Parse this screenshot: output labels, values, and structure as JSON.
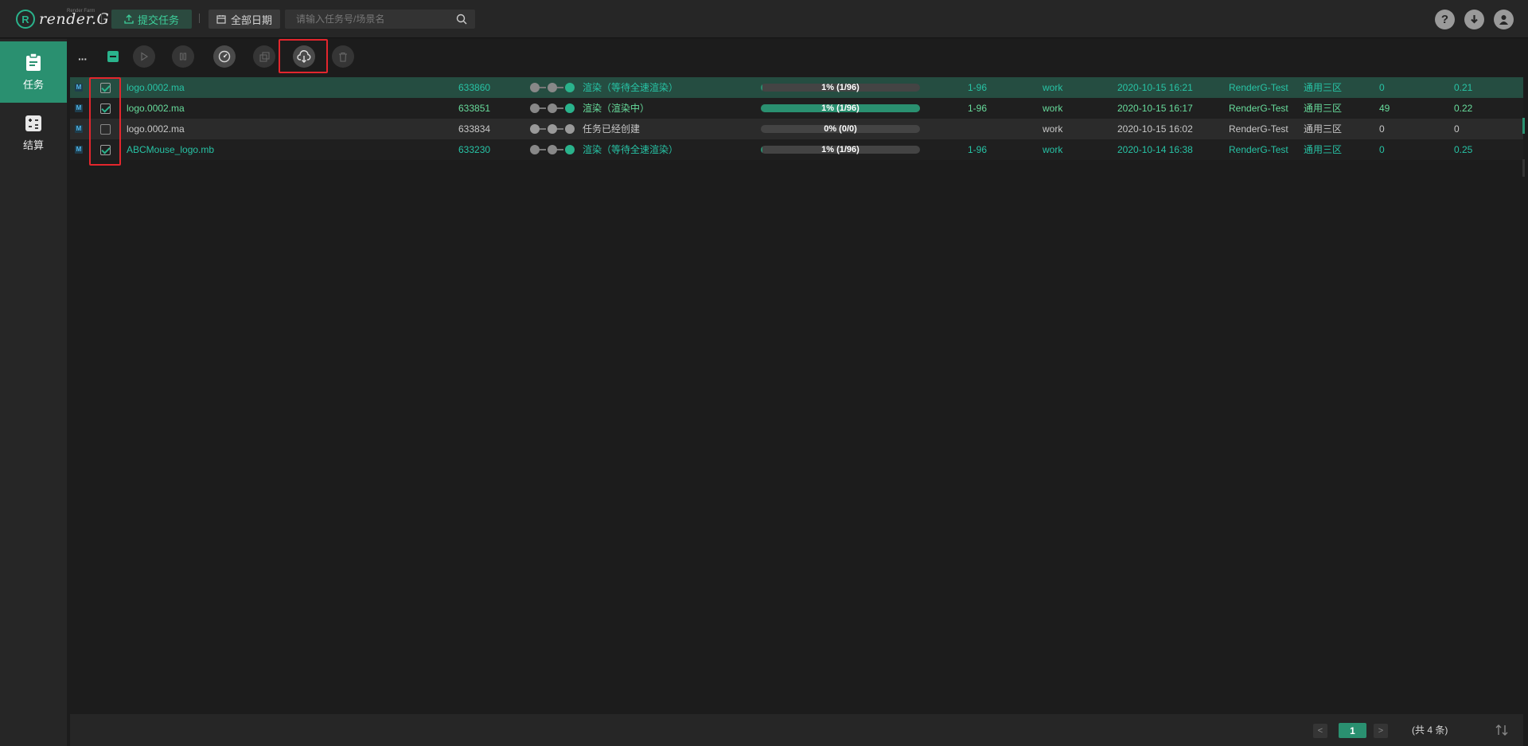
{
  "header": {
    "logo_letter": "R",
    "logo_text": "render.G",
    "logo_sub": "Render Farm",
    "submit_label": "提交任务",
    "date_label": "全部日期",
    "search_placeholder": "请输入任务号/场景名"
  },
  "sidebar": {
    "items": [
      {
        "label": "任务",
        "icon": "clipboard-icon",
        "active": true
      },
      {
        "label": "结算",
        "icon": "calculator-icon",
        "active": false
      }
    ]
  },
  "toolbar": {
    "more_label": "···",
    "tools": [
      "play-icon",
      "pause-icon",
      "speedometer-icon",
      "copy-icon",
      "cloud-download-icon",
      "trash-icon"
    ]
  },
  "tasks": [
    {
      "badge": "M",
      "checked": true,
      "name": "logo.0002.ma",
      "id": "633860",
      "status": "渲染（等待全速渲染）",
      "progress_label": "1% (1/96)",
      "progress": 0.01,
      "frames": "1-96",
      "project": "work",
      "time": "2020-10-15 16:21",
      "user": "RenderG-Test",
      "zone": "通用三区",
      "count": "0",
      "cost": "0.21"
    },
    {
      "badge": "M",
      "checked": true,
      "name": "logo.0002.ma",
      "id": "633851",
      "status": "渲染（渲染中）",
      "progress_label": "1% (1/96)",
      "progress": 1.0,
      "frames": "1-96",
      "project": "work",
      "time": "2020-10-15 16:17",
      "user": "RenderG-Test",
      "zone": "通用三区",
      "count": "49",
      "cost": "0.22"
    },
    {
      "badge": "M",
      "checked": false,
      "name": "logo.0002.ma",
      "id": "633834",
      "status": "任务已经创建",
      "progress_label": "0% (0/0)",
      "progress": 0.0,
      "frames": "",
      "project": "work",
      "time": "2020-10-15 16:02",
      "user": "RenderG-Test",
      "zone": "通用三区",
      "count": "0",
      "cost": "0"
    },
    {
      "badge": "M",
      "checked": true,
      "name": "ABCMouse_logo.mb",
      "id": "633230",
      "status": "渲染（等待全速渲染）",
      "progress_label": "1% (1/96)",
      "progress": 0.01,
      "frames": "1-96",
      "project": "work",
      "time": "2020-10-14 16:38",
      "user": "RenderG-Test",
      "zone": "通用三区",
      "count": "0",
      "cost": "0.25"
    }
  ],
  "pagination": {
    "prev": "<",
    "current": "1",
    "next": ">",
    "total": "(共 4 条)"
  },
  "colors": {
    "accent": "#2a9070",
    "teal_text": "#27c3a5",
    "green_text": "#67dc9c",
    "highlight": "#e3262d"
  }
}
